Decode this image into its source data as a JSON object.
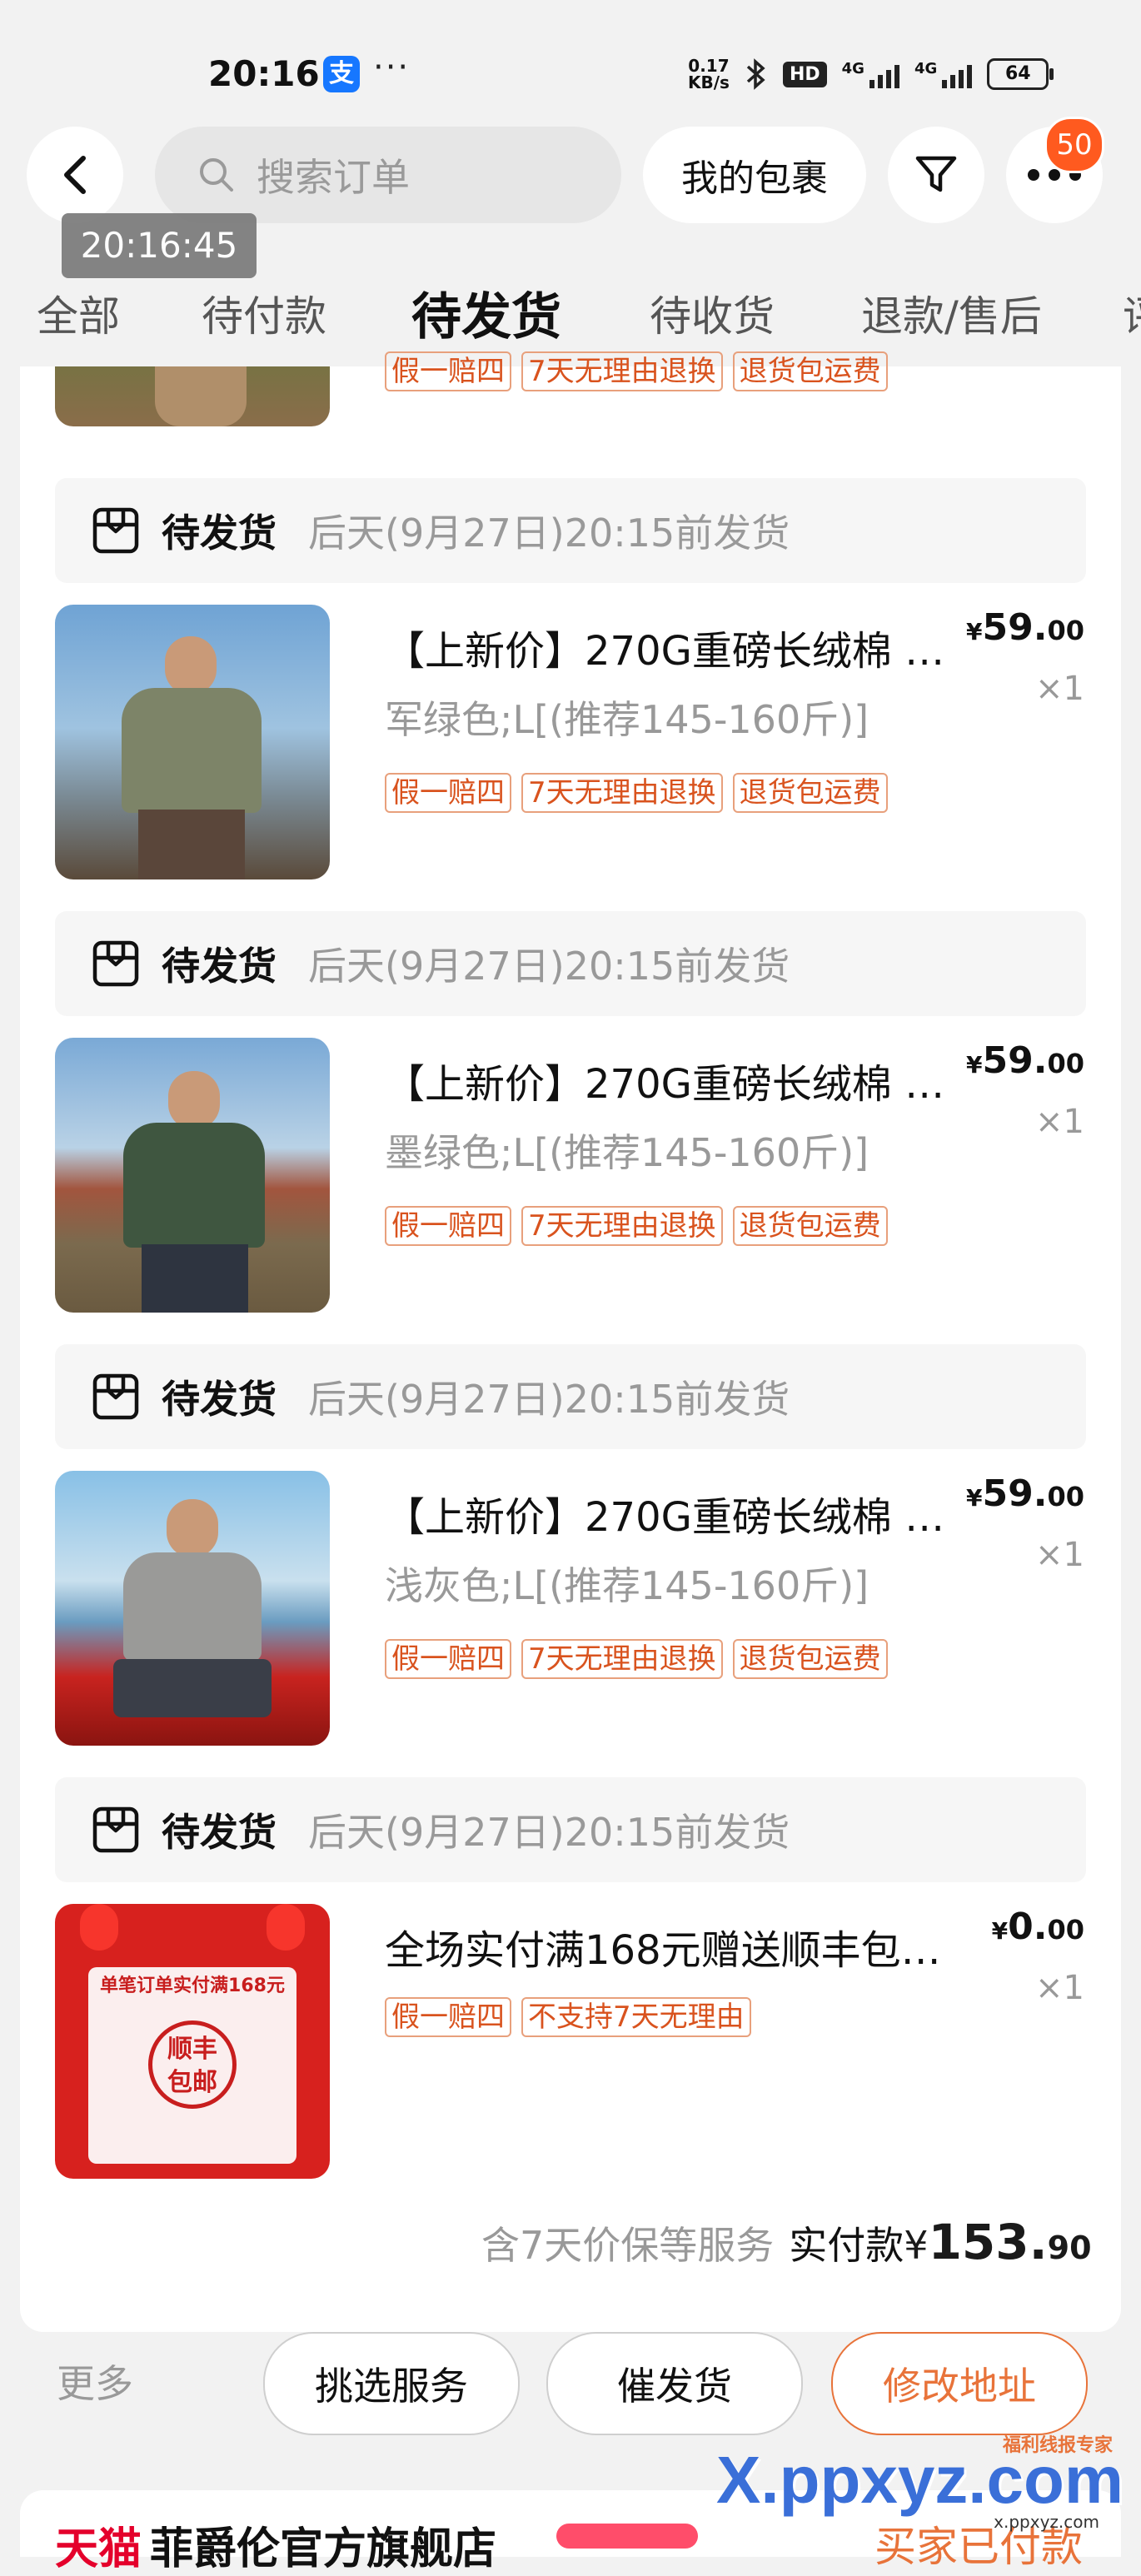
{
  "status_bar": {
    "time": "20:16",
    "alipay_icon": "支",
    "dots": "···",
    "net_speed_value": "0.17",
    "net_speed_unit": "KB/s",
    "hd": "HD",
    "signal1": "4G",
    "signal2": "4G",
    "battery": "64"
  },
  "header": {
    "search_placeholder": "搜索订单",
    "packages_label": "我的包裹",
    "more_badge": "50",
    "time_tip": "20:16:45"
  },
  "tabs": [
    {
      "label": "全部"
    },
    {
      "label": "待付款"
    },
    {
      "label": "待发货",
      "active": true
    },
    {
      "label": "待收货"
    },
    {
      "label": "退款/售后"
    },
    {
      "label": "评"
    }
  ],
  "orders": [
    {
      "status": "待发货",
      "deadline": "后天(9月27日)20:15前发货",
      "title": "【上新价】270G重磅长绒棉 …",
      "spec": "军绿色;L[(推荐145-160斤)]",
      "tags": [
        "假一赔四",
        "7天无理由退换",
        "退货包运费"
      ],
      "price_symbol": "¥",
      "price_int": "59.",
      "price_dec": "00",
      "qty": "×1",
      "shirt_color": "#7d8468"
    },
    {
      "status": "待发货",
      "deadline": "后天(9月27日)20:15前发货",
      "title": "【上新价】270G重磅长绒棉 …",
      "spec": "墨绿色;L[(推荐145-160斤)]",
      "tags": [
        "假一赔四",
        "7天无理由退换",
        "退货包运费"
      ],
      "price_symbol": "¥",
      "price_int": "59.",
      "price_dec": "00",
      "qty": "×1",
      "shirt_color": "#3f5640"
    },
    {
      "status": "待发货",
      "deadline": "后天(9月27日)20:15前发货",
      "title": "【上新价】270G重磅长绒棉 …",
      "spec": "浅灰色;L[(推荐145-160斤)]",
      "tags": [
        "假一赔四",
        "7天无理由退换",
        "退货包运费"
      ],
      "price_symbol": "¥",
      "price_int": "59.",
      "price_dec": "00",
      "qty": "×1",
      "shirt_color": "#9a9a98"
    },
    {
      "status": "待发货",
      "deadline": "后天(9月27日)20:15前发货",
      "title": "全场实付满168元赠送顺丰包…",
      "spec": "",
      "tags": [
        "假一赔四",
        "不支持7天无理由"
      ],
      "price_symbol": "¥",
      "price_int": "0.",
      "price_dec": "00",
      "qty": "×1",
      "promo_heading": "单笔订单实付满168元",
      "promo_stamp_1": "顺丰",
      "promo_stamp_2": "包邮"
    }
  ],
  "top_partial_tags": [
    "假一赔四",
    "7天无理由退换",
    "退货包运费"
  ],
  "summary": {
    "note": "含7天价保等服务",
    "label": "实付款",
    "symbol": "¥",
    "amount_int": "153.",
    "amount_dec": "90"
  },
  "actions": {
    "more": "更多",
    "service": "挑选服务",
    "urge": "催发货",
    "address": "修改地址"
  },
  "next_order": {
    "shop_prefix": "天猫",
    "shop_name": "菲爵伦官方旗舰店",
    "status": "买家已付款"
  },
  "watermark": {
    "text": "X.ppxyz.com",
    "sub": "福利线报专家",
    "url": "x.ppxyz.com"
  },
  "colors": {
    "accent": "#e8733a",
    "badge": "#ff5a1f",
    "tmall": "#e4002b"
  }
}
